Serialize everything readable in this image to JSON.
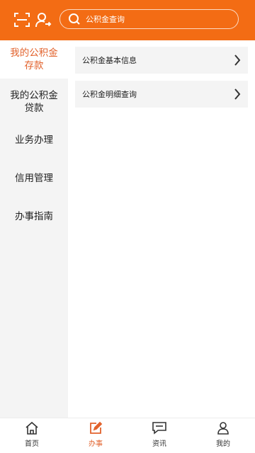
{
  "header": {
    "scan_icon": "scan-icon",
    "user_icon": "user-switch-icon",
    "search": {
      "icon": "search-icon",
      "placeholder": "公积金查询"
    },
    "background_color": "#f36c14"
  },
  "sidebar": {
    "items": [
      {
        "label": "我的公积金存款",
        "active": true
      },
      {
        "label": "我的公积金贷款",
        "active": false
      },
      {
        "label": "业务办理",
        "active": false
      },
      {
        "label": "信用管理",
        "active": false
      },
      {
        "label": "办事指南",
        "active": false
      }
    ],
    "active_color": "#e2622c"
  },
  "main": {
    "rows": [
      {
        "label": "公积金基本信息",
        "icon": "chevron-right-icon"
      },
      {
        "label": "公积金明细查询",
        "icon": "chevron-right-icon"
      }
    ]
  },
  "tabbar": {
    "tabs": [
      {
        "label": "首页",
        "icon": "home-icon",
        "active": false
      },
      {
        "label": "办事",
        "icon": "edit-icon",
        "active": true
      },
      {
        "label": "资讯",
        "icon": "chat-icon",
        "active": false
      },
      {
        "label": "我的",
        "icon": "profile-icon",
        "active": false
      }
    ],
    "active_color": "#e2622c"
  }
}
